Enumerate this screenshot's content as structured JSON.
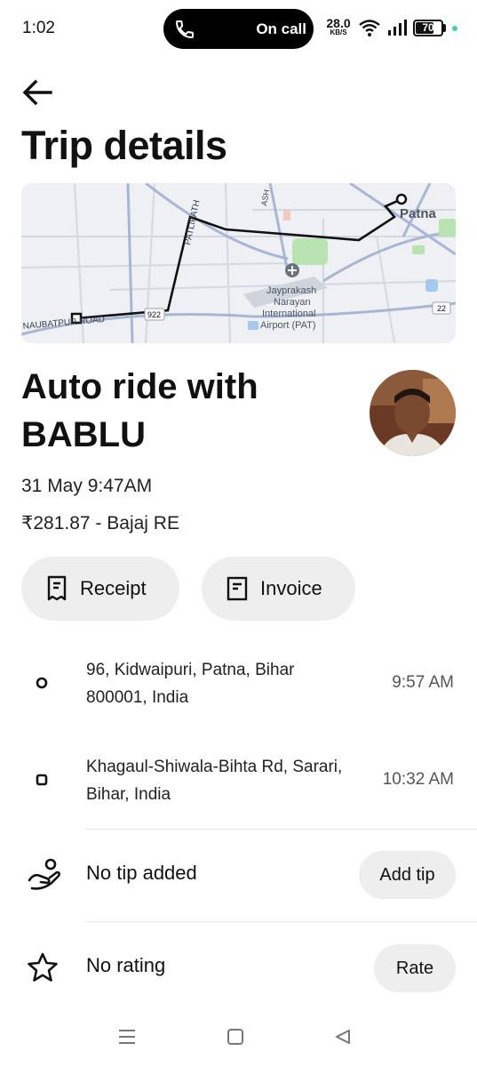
{
  "status_bar": {
    "time": "1:02",
    "call_label": "On call",
    "net_speed": "28.0",
    "net_unit": "KB/S",
    "battery": "70",
    "battery_level": 0.7
  },
  "header": {
    "back_icon": "arrow-left-icon",
    "title": "Trip details"
  },
  "map": {
    "place_labels": [
      "Patna",
      "Jayprakash",
      "Narayan",
      "International",
      "Airport (PAT)"
    ],
    "road_labels": [
      "PATLIPATH",
      "ASH",
      "NAUBATPUR ROAD"
    ],
    "road_badges": [
      "922",
      "22"
    ]
  },
  "ride": {
    "title": "Auto ride with BABLU",
    "date": "31 May 9:47AM",
    "fare": "₹281.87 - Bajaj RE"
  },
  "actions": {
    "receipt_label": "Receipt",
    "invoice_label": "Invoice"
  },
  "stops": [
    {
      "address": "96, Kidwaipuri, Patna, Bihar 800001, India",
      "time": "9:57 AM"
    },
    {
      "address": "Khagaul-Shiwala-Bihta Rd, Sarari, Bihar, India",
      "time": "10:32 AM"
    }
  ],
  "tip": {
    "label": "No tip added",
    "button": "Add tip",
    "icon": "hand-heart-icon"
  },
  "rating": {
    "label": "No rating",
    "button": "Rate",
    "icon": "star-icon"
  },
  "nav": {
    "icons": [
      "menu-icon",
      "home-square-icon",
      "back-triangle-icon"
    ]
  }
}
